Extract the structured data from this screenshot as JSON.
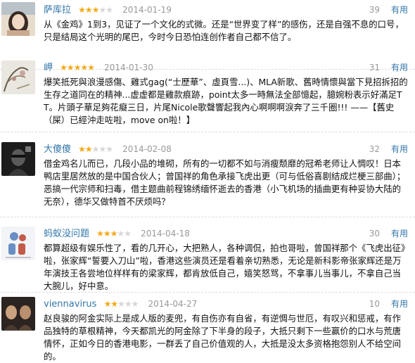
{
  "reviews": [
    {
      "user": "萨库拉",
      "rating": 3,
      "date": "2014-01-19",
      "votes": "39",
      "useful": "有用",
      "text": "从《金鸡》1到3，见证了一个文化的式微。还是“世界变了样”的感伤，还是自强不息的口号，只是结局这个光明的尾巴，今时今日恐怕连创作者自己都不信了。"
    },
    {
      "user": "岬",
      "rating": 5,
      "date": "2014-01-30",
      "votes": "31",
      "useful": "有用",
      "text": "爆笑抵死與浪漫感傷、雞式gag(“士歷華”、虛頁雪...)、MLA新歌、舊時情懷與當下見招拆招的生存之道同在的精神...虚虚都是雞款痕跡，point太多一時無法全部憶起，臆婉粉表示好滿足TT。片頭子華足夠花癡三日，片尾Nicole歌聲響起我內心啊啊啊淚奔了三千圈!!! ——【舊史（屎）已經沖走咗啦，move on啦！】"
    },
    {
      "user": "大傻傻",
      "rating": 2,
      "date": "2014-02-08",
      "votes": "32",
      "useful": "有用",
      "text": "借金鸡名儿而已，几段小品的堆砌，所有的一切都不如与消瘦颓靡的冠希老师让人惆叹！日本鸭店里居然放的是中国合伙人；曾国祥的角色承接飞虎出更（可与低俗喜剧结成烂梗三部曲）；恶搞一代宗师和扫毒，借主题曲前程锦绣缅怀逝去的香港（小飞机场的插曲更有种妥协大陆的无奈），德华又做特首不厌烦吗？"
    },
    {
      "user": "蚂蚁没问题",
      "rating": 3,
      "date": "2014-04-18",
      "votes": "30",
      "useful": "有用",
      "text": "都算超级有娱乐性了，看的几开心，大把熟人，各种调侃，拍也哥啦，曾国祥那个《飞虎出征》啦，张家辉“誓要入刀山”啦，香港这些演员还是看着亲切熟悉，无论是新科影帝张家辉还是万年演技王各尝地位样样有的梁家辉，都肯放低自己，嬉笑怒骂，不拿事儿当事儿，不拿自己当大腕儿，好中意。"
    },
    {
      "user": "viennavirus",
      "rating": 2,
      "date": "2014-04-27",
      "votes": "10",
      "useful": "有用",
      "text": "赵良骏的阿金实际上是成人版的麦兜，有自伤亦有自省，有逆惆与世厄，有叹兴和惩戒，有作品独特的草根精神，今天都凯光的阿金除了下半身的段子，大抵只剩下一些赢价的口水与荒唐情怀，正如今日的香港电影，一群丢了自己价值观的人，大抵是没太多资格抱怨别人不给空间的。"
    }
  ]
}
